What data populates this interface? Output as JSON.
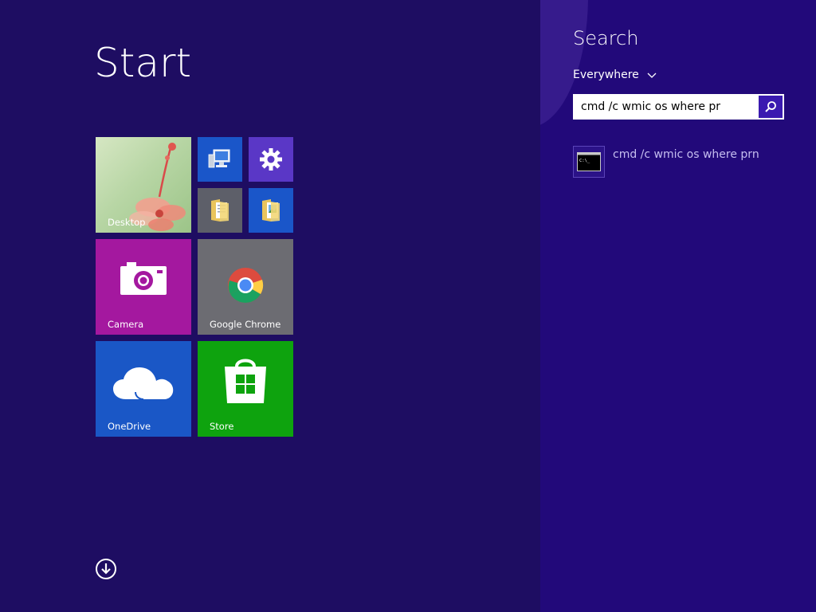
{
  "start": {
    "title": "Start",
    "tiles": {
      "desktop": "Desktop",
      "camera": "Camera",
      "chrome": "Google Chrome",
      "onedrive": "OneDrive",
      "store": "Store"
    },
    "icons": {
      "computer": "computer-icon",
      "settings": "gear-icon",
      "folder": "folder-icon",
      "folder_pictures": "pictures-folder-icon",
      "camera": "camera-icon",
      "chrome": "chrome-icon",
      "onedrive": "cloud-icon",
      "store": "store-bag-icon",
      "all_apps": "arrow-down-circle-icon"
    }
  },
  "search": {
    "title": "Search",
    "scope": "Everywhere",
    "query": "cmd /c wmic os where pr",
    "results": [
      {
        "label": "cmd /c wmic os where prn",
        "icon": "command-prompt-icon"
      }
    ]
  },
  "colors": {
    "background": "#1e0d62",
    "search_pane": "#22097a",
    "accent": "#3a1ab0",
    "camera_tile": "#a4189f",
    "store_tile": "#0ea30e",
    "blue_tile": "#1a56c9"
  }
}
